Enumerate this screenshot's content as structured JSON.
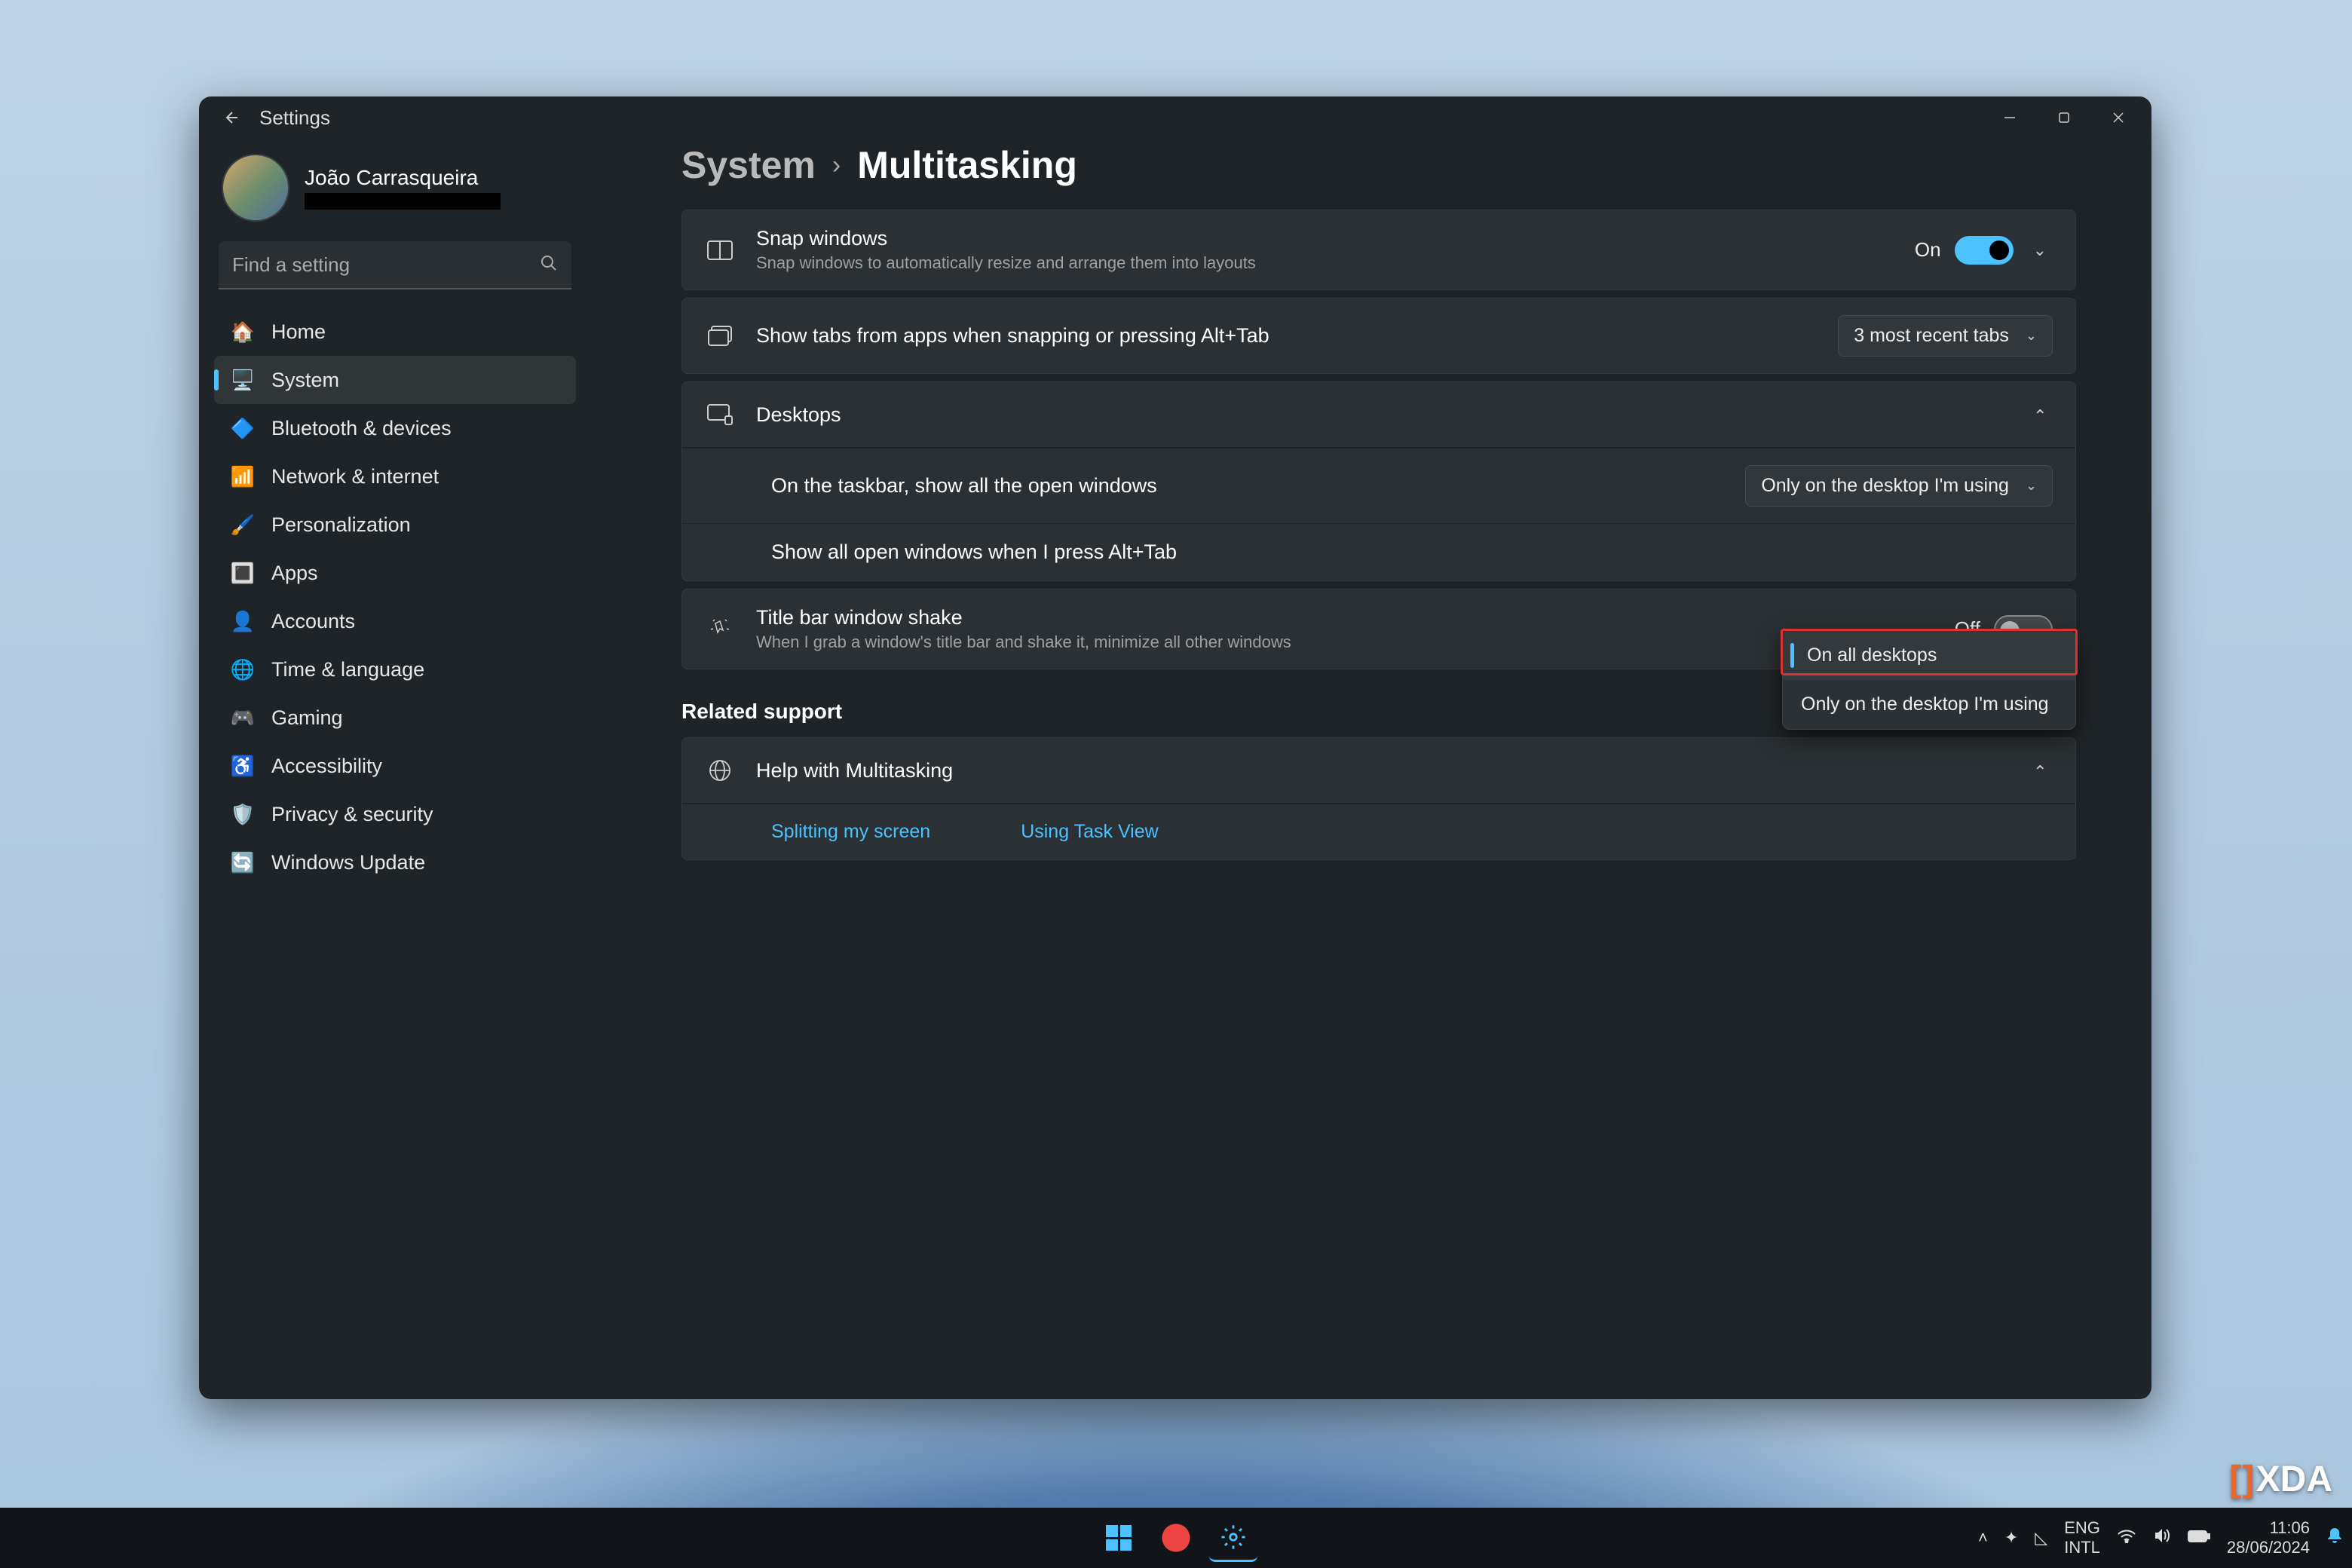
{
  "window": {
    "title": "Settings",
    "user_name": "João Carrasqueira"
  },
  "search": {
    "placeholder": "Find a setting"
  },
  "sidebar": {
    "items": [
      {
        "label": "Home",
        "icon": "🏠"
      },
      {
        "label": "System",
        "icon": "🖥️"
      },
      {
        "label": "Bluetooth & devices",
        "icon": "🔷"
      },
      {
        "label": "Network & internet",
        "icon": "📶"
      },
      {
        "label": "Personalization",
        "icon": "🖌️"
      },
      {
        "label": "Apps",
        "icon": "🔳"
      },
      {
        "label": "Accounts",
        "icon": "👤"
      },
      {
        "label": "Time & language",
        "icon": "🌐"
      },
      {
        "label": "Gaming",
        "icon": "🎮"
      },
      {
        "label": "Accessibility",
        "icon": "♿"
      },
      {
        "label": "Privacy & security",
        "icon": "🛡️"
      },
      {
        "label": "Windows Update",
        "icon": "🔄"
      }
    ],
    "active_index": 1
  },
  "breadcrumb": {
    "parent": "System",
    "current": "Multitasking"
  },
  "snap": {
    "title": "Snap windows",
    "subtitle": "Snap windows to automatically resize and arrange them into layouts",
    "state_label": "On"
  },
  "tabs_row": {
    "title": "Show tabs from apps when snapping or pressing Alt+Tab",
    "dropdown_value": "3 most recent tabs"
  },
  "desktops": {
    "title": "Desktops",
    "taskbar_label": "On the taskbar, show all the open windows",
    "taskbar_value": "Only on the desktop I'm using",
    "alttab_label": "Show all open windows when I press Alt+Tab"
  },
  "titleshake": {
    "title": "Title bar window shake",
    "subtitle": "When I grab a window's title bar and shake it, minimize all other windows",
    "state_label": "Off"
  },
  "related": {
    "heading": "Related support",
    "help_title": "Help with Multitasking",
    "links": [
      "Splitting my screen",
      "Using Task View"
    ]
  },
  "popup": {
    "options": [
      "On all desktops",
      "Only on the desktop I'm using"
    ],
    "selected_index": 0
  },
  "taskbar": {
    "lang_top": "ENG",
    "lang_bottom": "INTL",
    "time": "11:06",
    "date": "28/06/2024"
  },
  "watermark": {
    "text": "XDA"
  }
}
